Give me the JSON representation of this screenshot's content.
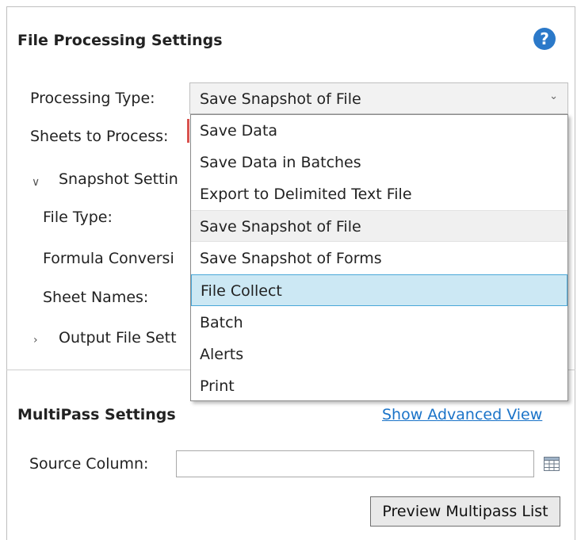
{
  "file_processing": {
    "title": "File Processing Settings",
    "help_icon": "?",
    "processing_type_label": "Processing Type:",
    "processing_type_value": "Save Snapshot of File",
    "sheets_label": "Sheets to Process:",
    "snapshot_section": "Snapshot Settin",
    "file_type_label": "File Type:",
    "formula_label": "Formula Conversi",
    "sheet_names_label": "Sheet Names:",
    "output_section": "Output File Sett"
  },
  "dropdown": {
    "options": [
      "Save Data",
      "Save Data in Batches",
      "Export to Delimited Text File",
      "Save Snapshot of File",
      "Save Snapshot of Forms",
      "File Collect",
      "Batch",
      "Alerts",
      "Print"
    ],
    "selected_index": 3,
    "hover_index": 5
  },
  "multipass": {
    "title": "MultiPass Settings",
    "advanced_link": "Show Advanced View",
    "source_column_label": "Source Column:",
    "source_column_value": "",
    "preview_button": "Preview Multipass List"
  },
  "colors": {
    "accent": "#2b79c9",
    "link": "#1a73c8",
    "hover_bg": "#cce8f4",
    "hover_border": "#49a7d8",
    "required_marker": "#d9534f"
  }
}
